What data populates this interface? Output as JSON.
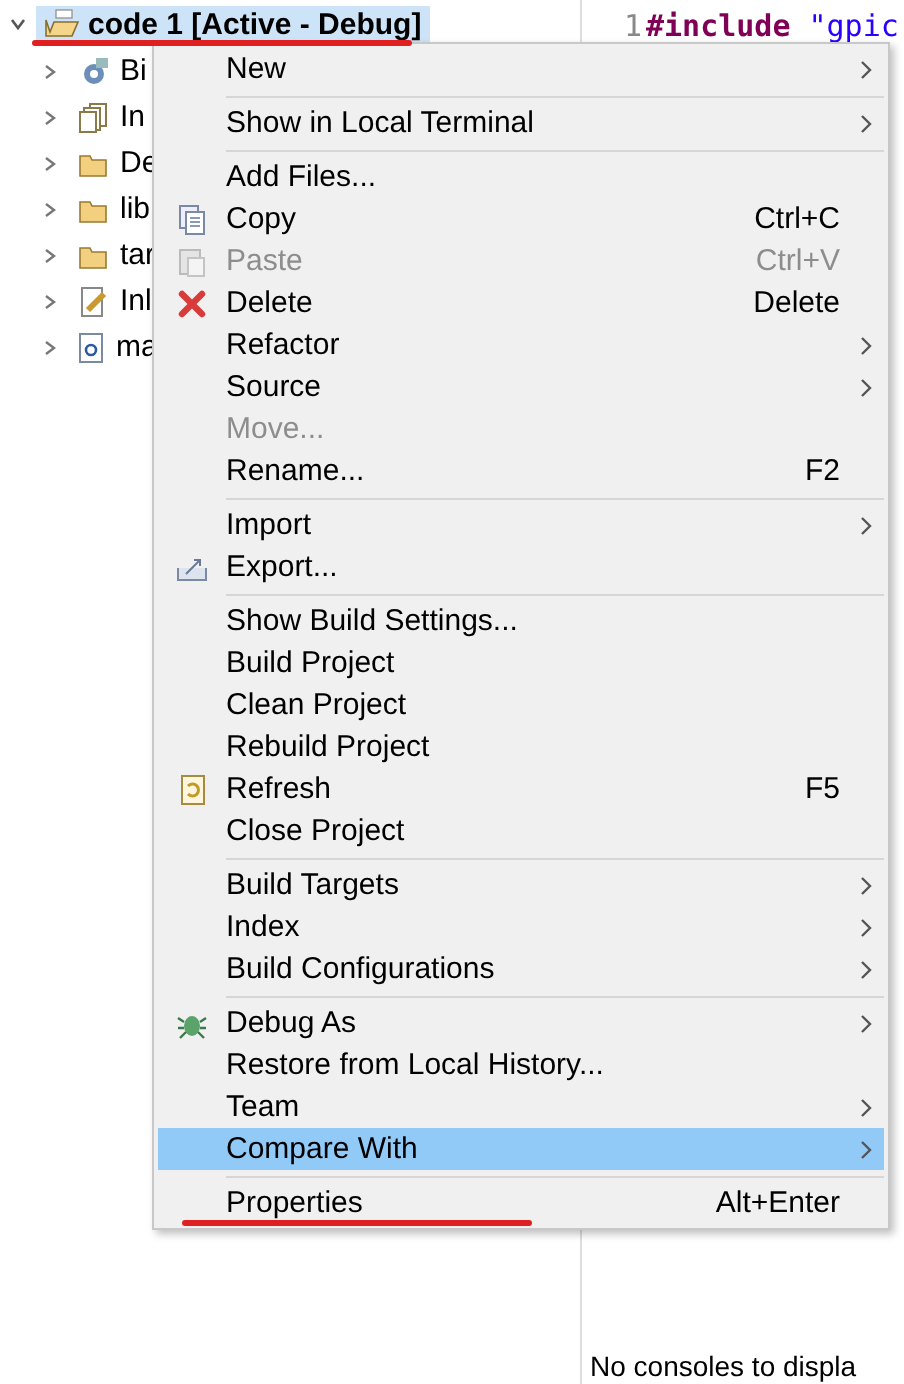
{
  "tree": {
    "root": {
      "label": "code 1 [Active - Debug]",
      "expanded": true,
      "selected": true
    },
    "children": [
      {
        "label": "Bi",
        "kind": "binaries"
      },
      {
        "label": "In",
        "kind": "includes"
      },
      {
        "label": "De",
        "kind": "folder"
      },
      {
        "label": "lib",
        "kind": "folder"
      },
      {
        "label": "tar",
        "kind": "folder"
      },
      {
        "label": "Inl",
        "kind": "linker"
      },
      {
        "label": "ma",
        "kind": "cfile"
      }
    ]
  },
  "editor": {
    "line_number": "1",
    "keyword": "#include",
    "string": "\"gpic"
  },
  "console": {
    "message": "No consoles to displa"
  },
  "context_menu": {
    "groups": [
      [
        {
          "label": "New",
          "submenu": true,
          "disabled": false,
          "selected": false,
          "kind": "plain"
        }
      ],
      [
        {
          "label": "Show in Local Terminal",
          "submenu": true,
          "disabled": false,
          "selected": false,
          "kind": "plain"
        }
      ],
      [
        {
          "label": "Add Files...",
          "submenu": false,
          "disabled": false,
          "selected": false,
          "kind": "plain"
        },
        {
          "label": "Copy",
          "shortcut": "Ctrl+C",
          "submenu": false,
          "disabled": false,
          "selected": false,
          "kind": "copy"
        },
        {
          "label": "Paste",
          "shortcut": "Ctrl+V",
          "submenu": false,
          "disabled": true,
          "selected": false,
          "kind": "paste"
        },
        {
          "label": "Delete",
          "shortcut": "Delete",
          "submenu": false,
          "disabled": false,
          "selected": false,
          "kind": "delete"
        },
        {
          "label": "Refactor",
          "submenu": true,
          "disabled": false,
          "selected": false,
          "kind": "plain"
        },
        {
          "label": "Source",
          "submenu": true,
          "disabled": false,
          "selected": false,
          "kind": "plain"
        },
        {
          "label": "Move...",
          "submenu": false,
          "disabled": true,
          "selected": false,
          "kind": "plain"
        },
        {
          "label": "Rename...",
          "shortcut": "F2",
          "submenu": false,
          "disabled": false,
          "selected": false,
          "kind": "plain"
        }
      ],
      [
        {
          "label": "Import",
          "submenu": true,
          "disabled": false,
          "selected": false,
          "kind": "plain"
        },
        {
          "label": "Export...",
          "submenu": false,
          "disabled": false,
          "selected": false,
          "kind": "export"
        }
      ],
      [
        {
          "label": "Show Build Settings...",
          "submenu": false,
          "disabled": false,
          "selected": false,
          "kind": "plain"
        },
        {
          "label": "Build Project",
          "submenu": false,
          "disabled": false,
          "selected": false,
          "kind": "plain"
        },
        {
          "label": "Clean Project",
          "submenu": false,
          "disabled": false,
          "selected": false,
          "kind": "plain"
        },
        {
          "label": "Rebuild Project",
          "submenu": false,
          "disabled": false,
          "selected": false,
          "kind": "plain"
        },
        {
          "label": "Refresh",
          "shortcut": "F5",
          "submenu": false,
          "disabled": false,
          "selected": false,
          "kind": "refresh"
        },
        {
          "label": "Close Project",
          "submenu": false,
          "disabled": false,
          "selected": false,
          "kind": "plain"
        }
      ],
      [
        {
          "label": "Build Targets",
          "submenu": true,
          "disabled": false,
          "selected": false,
          "kind": "plain"
        },
        {
          "label": "Index",
          "submenu": true,
          "disabled": false,
          "selected": false,
          "kind": "plain"
        },
        {
          "label": "Build Configurations",
          "submenu": true,
          "disabled": false,
          "selected": false,
          "kind": "plain"
        }
      ],
      [
        {
          "label": "Debug As",
          "submenu": true,
          "disabled": false,
          "selected": false,
          "kind": "debug"
        },
        {
          "label": "Restore from Local History...",
          "submenu": false,
          "disabled": false,
          "selected": false,
          "kind": "plain"
        },
        {
          "label": "Team",
          "submenu": true,
          "disabled": false,
          "selected": false,
          "kind": "plain"
        },
        {
          "label": "Compare With",
          "submenu": true,
          "disabled": false,
          "selected": true,
          "kind": "plain"
        }
      ],
      [
        {
          "label": "Properties",
          "shortcut": "Alt+Enter",
          "submenu": false,
          "disabled": false,
          "selected": false,
          "kind": "plain"
        }
      ]
    ]
  }
}
